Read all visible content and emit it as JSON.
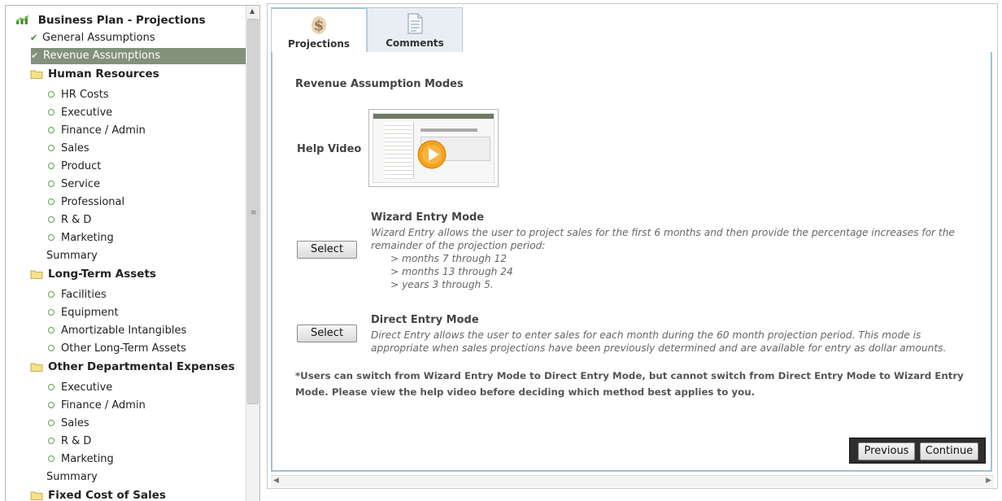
{
  "sidebar": {
    "root": "Business Plan - Projections",
    "general": "General Assumptions",
    "revenue": "Revenue Assumptions",
    "human_resources": {
      "title": "Human Resources",
      "items": [
        "HR Costs",
        "Executive",
        "Finance / Admin",
        "Sales",
        "Product",
        "Service",
        "Professional",
        "R & D",
        "Marketing"
      ],
      "summary": "Summary"
    },
    "long_term_assets": {
      "title": "Long-Term Assets",
      "items": [
        "Facilities",
        "Equipment",
        "Amortizable Intangibles",
        "Other Long-Term Assets"
      ]
    },
    "other_departmental": {
      "title": "Other Departmental Expenses",
      "items": [
        "Executive",
        "Finance / Admin",
        "Sales",
        "R & D",
        "Marketing"
      ],
      "summary": "Summary"
    },
    "fixed_cost": {
      "title": "Fixed Cost of Sales"
    }
  },
  "tabs": [
    {
      "label": "Projections",
      "icon": "dollar-sign-icon",
      "active": true
    },
    {
      "label": "Comments",
      "icon": "document-icon",
      "active": false
    }
  ],
  "main": {
    "title": "Revenue Assumption Modes",
    "help_video_label": "Help Video",
    "wizard": {
      "button": "Select",
      "heading": "Wizard Entry Mode",
      "description": "Wizard Entry allows the user to project sales for the first 6 months and then provide the percentage increases for the remainder of the projection period:",
      "options": [
        "> months 7 through 12",
        "> months 13 through 24",
        "> years 3 through 5."
      ]
    },
    "direct": {
      "button": "Select",
      "heading": "Direct Entry Mode",
      "description": "Direct Entry allows the user to enter sales for each month during the 60 month projection period. This mode is appropriate when sales projections have been previously determined and are available for entry as dollar amounts."
    },
    "note": "*Users can switch from Wizard Entry Mode to Direct Entry Mode, but cannot switch from Direct Entry Mode to Wizard Entry Mode. Please view the help video before deciding which method best applies to you."
  },
  "nav": {
    "previous": "Previous",
    "continue": "Continue"
  },
  "colors": {
    "selected_bg": "#82917c",
    "tab_border": "#9fc3d4",
    "navbar_bg": "#2e2e2e",
    "bullet": "#5aa64a"
  }
}
